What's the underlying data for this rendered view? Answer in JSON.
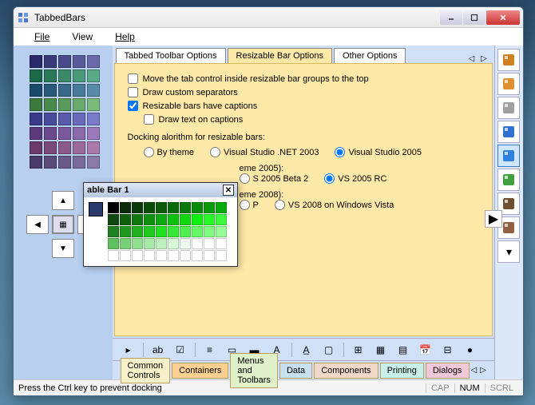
{
  "window": {
    "title": "TabbedBars"
  },
  "menu": {
    "file": "File",
    "view": "View",
    "help": "Help"
  },
  "tabs": {
    "items": [
      "Tabbed Toolbar Options",
      "Resizable Bar Options",
      "Other Options"
    ],
    "active_index": 1
  },
  "options": {
    "move_tab_top": "Move the tab control inside resizable bar groups to the top",
    "draw_separators": "Draw custom separators",
    "have_captions": "Resizable bars have captions",
    "draw_text_captions": "Draw text on captions",
    "docking_label": "Docking alorithm for resizable bars:",
    "algo": {
      "by_theme": "By theme",
      "vs2003": "Visual Studio .NET 2003",
      "vs2005": "Visual Studio 2005"
    },
    "theme2005_suffix": "eme 2005):",
    "theme2005": {
      "beta2": "S 2005 Beta 2",
      "rc": "VS 2005 RC"
    },
    "theme2008_suffix": "eme 2008):",
    "theme2008": {
      "p": "P",
      "vista": "VS 2008 on Windows Vista"
    }
  },
  "floating": {
    "title": "able Bar 1"
  },
  "left_colors": [
    "#2a2a6a",
    "#3a3a7a",
    "#4a4a8a",
    "#5a5a9a",
    "#6a6aaa",
    "#1a6a4a",
    "#2a7a5a",
    "#3a8a6a",
    "#4a9a7a",
    "#5aaa8a",
    "#1a4a6a",
    "#2a5a7a",
    "#3a6a8a",
    "#4a7a9a",
    "#5a8aaa",
    "#3a7a3a",
    "#4a8a4a",
    "#5a9a5a",
    "#6aaa6a",
    "#7aba7a",
    "#3a3a8a",
    "#4a4a9a",
    "#5a5aaa",
    "#6a6aba",
    "#7a7aca",
    "#5a3a7a",
    "#6a4a8a",
    "#7a5a9a",
    "#8a6aaa",
    "#9a7aba",
    "#6a3a6a",
    "#7a4a7a",
    "#8a5a8a",
    "#9a6a9a",
    "#aa7aaa",
    "#4a3a6a",
    "#5a4a7a",
    "#6a5a8a",
    "#7a6a9a",
    "#8a7aaa"
  ],
  "green_palette": [
    "#000000",
    "#0a2a0a",
    "#0a3a0a",
    "#0a4a0a",
    "#0a5a0a",
    "#0a6a0a",
    "#0a7a0a",
    "#0a8a0a",
    "#0a9a0a",
    "#0aaa0a",
    "#104810",
    "#106010",
    "#107810",
    "#109010",
    "#10a810",
    "#10c010",
    "#10d810",
    "#10f010",
    "#28f828",
    "#40f840",
    "#208020",
    "#209820",
    "#20b020",
    "#20c820",
    "#20e020",
    "#38e838",
    "#50f050",
    "#68f868",
    "#80fc80",
    "#98fc98",
    "#60c060",
    "#78d078",
    "#90e090",
    "#a8e8a8",
    "#c0f0c0",
    "#d8f8d8",
    "#f0fcf0",
    "#ffffff",
    "#ffffff",
    "#ffffff",
    "#ffffff",
    "#ffffff",
    "#ffffff",
    "#ffffff",
    "#ffffff",
    "#ffffff",
    "#ffffff",
    "#ffffff",
    "#ffffff",
    "#ffffff"
  ],
  "bottom_tabs": {
    "items": [
      "Common Controls",
      "Containers",
      "Menus and Toolbars",
      "Data",
      "Components",
      "Printing",
      "Dialogs"
    ],
    "colors": [
      "#f8f0c8",
      "#ffd090",
      "#e0f0c8",
      "#c8e0f0",
      "#f0d8c8",
      "#c8f0e8",
      "#f0c8d8"
    ]
  },
  "rail_icons": [
    "office-icon",
    "office-orange-icon",
    "office-gray-icon",
    "windows-xp-icon",
    "vs-icon",
    "vs-5-icon",
    "office-dark-icon",
    "office-2-icon"
  ],
  "tool_icons": [
    "arrow-icon",
    "label-icon",
    "checkbox-icon",
    "list-icon",
    "combo-icon",
    "progress-icon",
    "font-icon",
    "underline-icon",
    "panel-icon",
    "grid-icon",
    "group-icon",
    "table-icon",
    "calendar-icon",
    "tree-icon",
    "dot-icon"
  ],
  "status": {
    "text": "Press the Ctrl key to prevent docking",
    "cap": "CAP",
    "num": "NUM",
    "scrl": "SCRL"
  }
}
